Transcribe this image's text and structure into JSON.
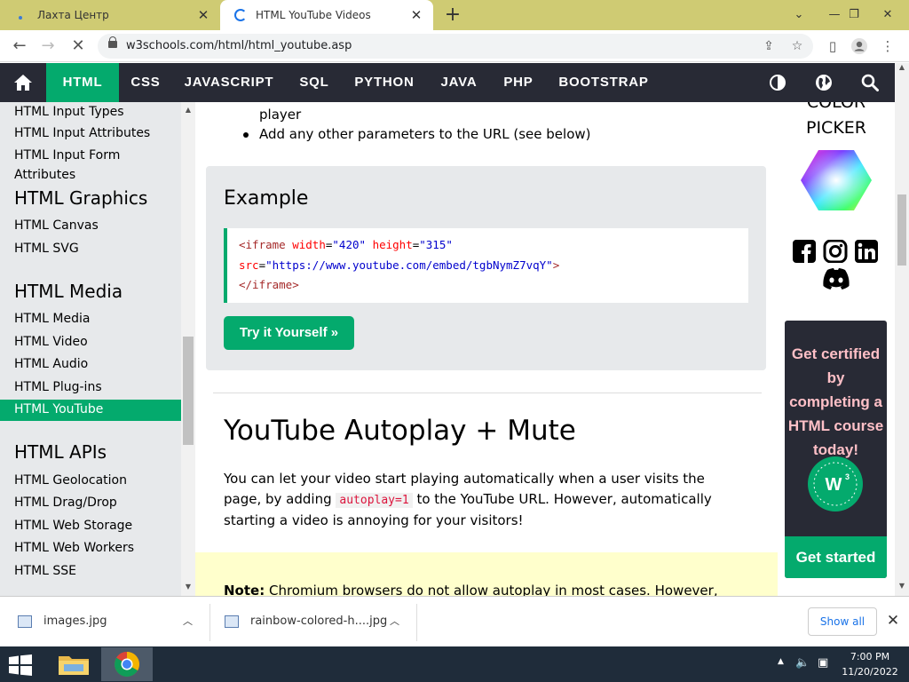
{
  "browser": {
    "tabs": [
      {
        "title": "Лахта Центр",
        "active": false
      },
      {
        "title": "HTML YouTube Videos",
        "active": true
      }
    ],
    "url": "w3schools.com/html/html_youtube.asp"
  },
  "nav": {
    "items": [
      "HTML",
      "CSS",
      "JAVASCRIPT",
      "SQL",
      "PYTHON",
      "JAVA",
      "PHP",
      "BOOTSTRAP"
    ],
    "active": "HTML",
    "accent": "#04aa6d",
    "bg": "#282a35"
  },
  "sidebar": {
    "group_top": [
      "HTML Input Types",
      "HTML Input Attributes",
      "HTML Input Form Attributes"
    ],
    "graphics_heading": "HTML Graphics",
    "graphics": [
      "HTML Canvas",
      "HTML SVG"
    ],
    "media_heading": "HTML Media",
    "media": [
      "HTML Media",
      "HTML Video",
      "HTML Audio",
      "HTML Plug-ins",
      "HTML YouTube"
    ],
    "active": "HTML YouTube",
    "apis_heading": "HTML APIs",
    "apis": [
      "HTML Geolocation",
      "HTML Drag/Drop",
      "HTML Web Storage",
      "HTML Web Workers",
      "HTML SSE"
    ]
  },
  "main": {
    "bullet_cont": "player",
    "bullet_2": "Add any other parameters to the URL (see below)",
    "example": {
      "heading": "Example",
      "code": {
        "tag_open": "<iframe",
        "attr_width": "width",
        "val_width": "\"420\"",
        "attr_height": "height",
        "val_height": "\"315\"",
        "attr_src": "src",
        "val_src": "\"https://www.youtube.com/embed/tgbNymZ7vqY\"",
        "gt": ">",
        "tag_close": "</iframe>",
        "eq": "="
      },
      "button": "Try it Yourself »"
    },
    "section_title": "YouTube Autoplay + Mute",
    "para_1": "You can let your video start playing automatically when a user visits the page, by adding",
    "para_kw": "autoplay=1",
    "para_2": "to the YouTube URL. However, automatically starting a video is annoying for your visitors!",
    "note_label": "Note:",
    "note_text": "Chromium browsers do not allow autoplay in most cases. However,"
  },
  "right": {
    "color": "COLOR",
    "picker": "PICKER",
    "cert_text": "Get certified by completing a HTML course today!",
    "cert_button": "Get started",
    "cert_text_color": "#ffc0c7"
  },
  "downloads": {
    "items": [
      "images.jpg",
      "rainbow-colored-h....jpg"
    ],
    "show_all": "Show all"
  },
  "taskbar": {
    "time": "7:00 PM",
    "date": "11/20/2022"
  }
}
